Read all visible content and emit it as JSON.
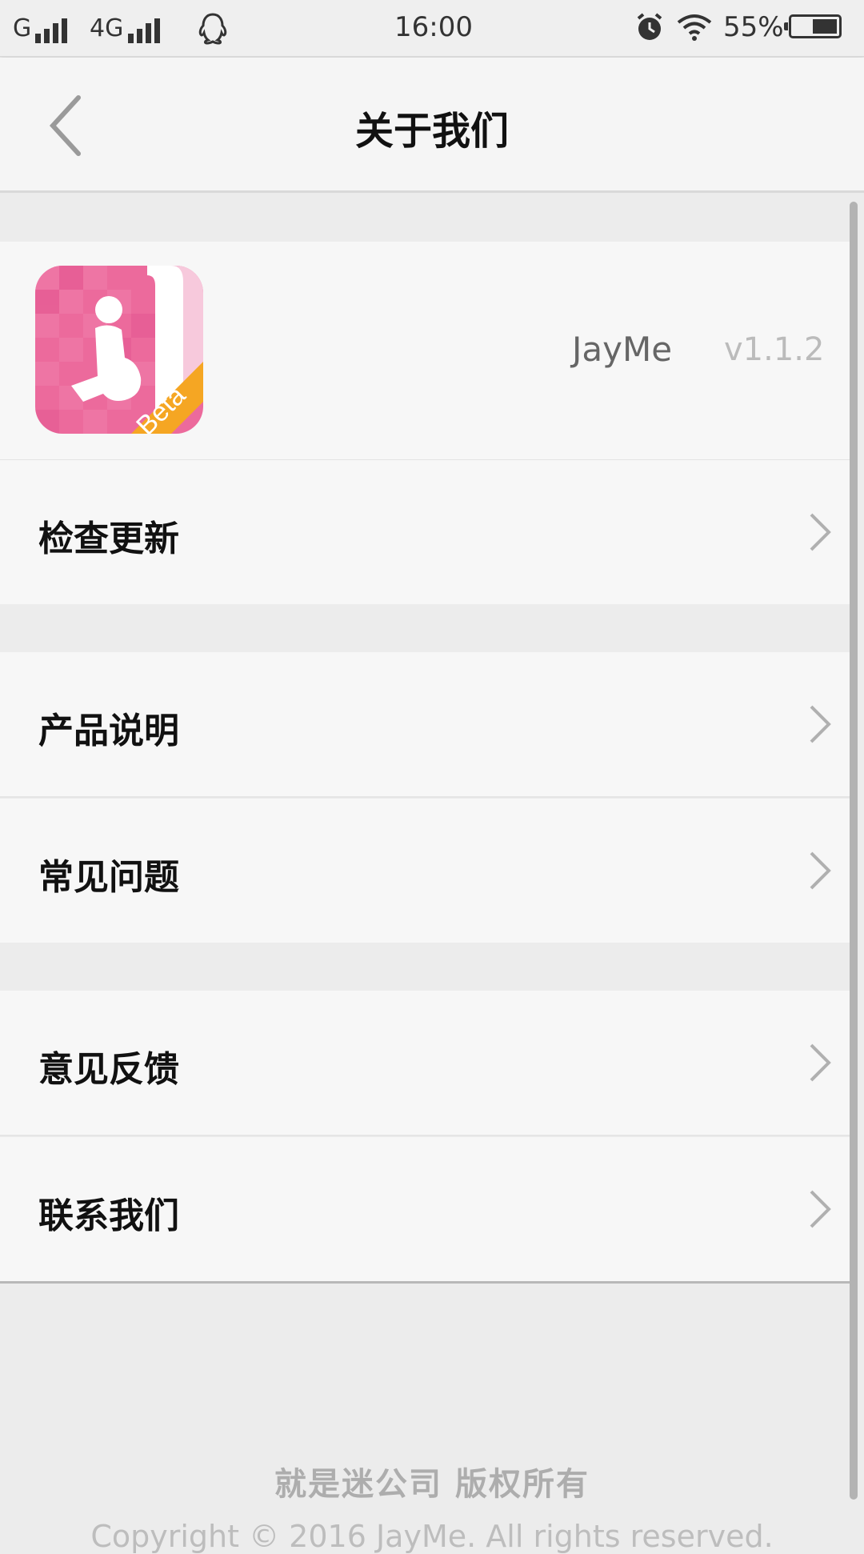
{
  "status_bar": {
    "network1": "G",
    "network2": "4G",
    "time": "16:00",
    "battery": "55%",
    "battery_level": 0.55,
    "icons": [
      "signal-icon",
      "signal-icon",
      "qq-penguin-icon",
      "alarm-icon",
      "wifi-icon",
      "battery-icon"
    ]
  },
  "header": {
    "title": "关于我们",
    "back_icon": "chevron-left-icon"
  },
  "app_info": {
    "name": "JayMe",
    "version": "v1.1.2",
    "badge": "Beta",
    "colors": {
      "icon_pink": "#ec6a9c",
      "badge_orange": "#f5a623"
    }
  },
  "menu": {
    "check_update": "检查更新",
    "product_info": "产品说明",
    "faq": "常见问题",
    "feedback": "意见反馈",
    "contact": "联系我们"
  },
  "footer": {
    "copyright_cn": "就是迷公司 版权所有",
    "copyright_en": "Copyright © 2016 JayMe. All rights reserved."
  }
}
